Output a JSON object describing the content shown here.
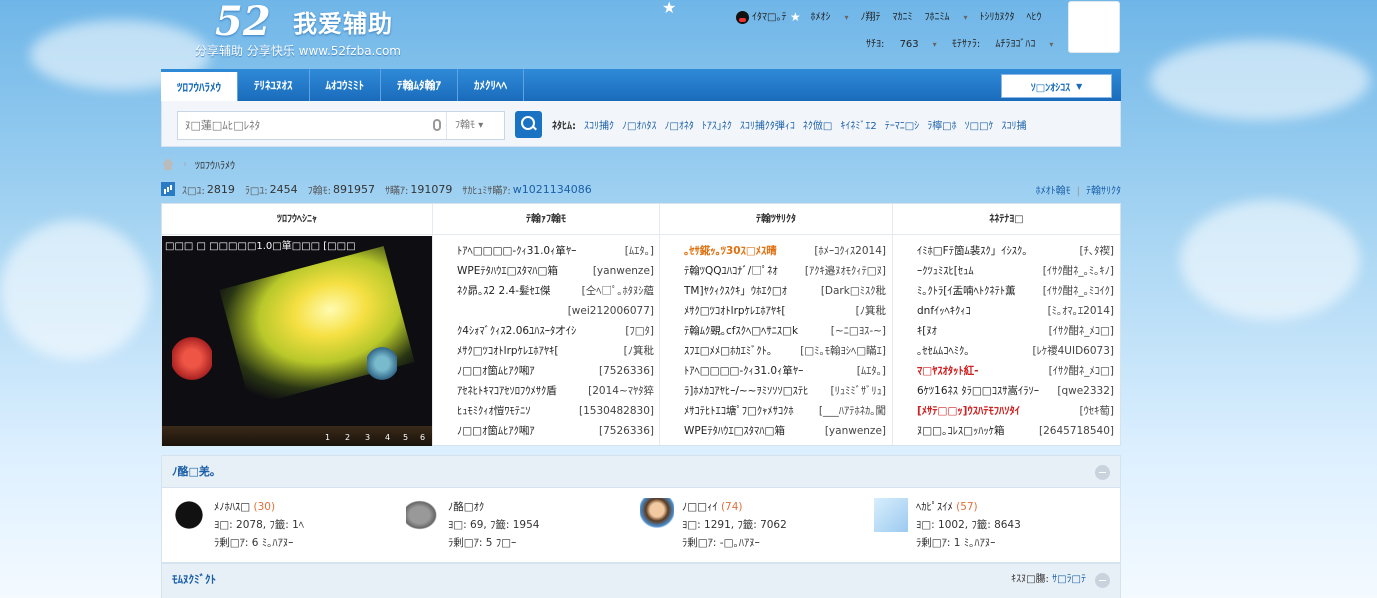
{
  "site": {
    "logo_big": "52",
    "logo_cn": "我爱辅助",
    "logo_sub": "分享辅助  分享快乐  www.52fzba.com"
  },
  "topbar": {
    "user": "ｲﾀﾏ□｡ﾃ",
    "items": [
      "ﾎﾒｵｼ",
      "ﾉ翔ﾃ",
      "ﾏｶﾆﾐ",
      "ﾌﾎﾆﾐﾑ",
      "ﾄｼﾘｶﾇｸﾀ",
      "ﾍﾋｳ"
    ],
    "points_label": "ｻﾁﾖ:",
    "points_value": "763",
    "group_label": "ﾓﾃｻｧﾗ:",
    "group_value": "ﾑﾁﾗﾖｺﾞﾊｺ"
  },
  "nav": {
    "tabs": [
      "ﾂﾛﾌｳﾊﾗﾒｳ",
      "ﾃﾘﾈﾕﾇｵｽ",
      "ﾑｵｺｳﾐﾐﾄ",
      "ﾃ翰ﾑﾀ翰ｱ",
      "ｶﾒｸﾘﾍﾍ"
    ],
    "right_button": "ｿ□ﾝｵｼｺｽ"
  },
  "search": {
    "placeholder": "ﾇ□蓮□ﾑﾋ□ﾚﾈﾀ",
    "type": "ﾌ翰ﾓ",
    "hot_label": "ﾈﾀﾋﾑ:",
    "hot_words": [
      "ｽｺﾘ捕ｸ",
      "ﾉ□ｵﾊﾀｽ",
      "ﾉ□ｵﾈﾀ",
      "ﾄｱｽ｣ﾈｸ",
      "ｽｺﾘ捕ｸﾀ弾ｨｺ",
      "ﾈｸ倣□",
      "ｷｲﾈﾐﾞｴ2",
      "ﾃｰﾏﾆ□ｼ",
      "ﾗ檸□ﾎ",
      "ｿ□□ｹ",
      "ｽｺﾘ捕"
    ]
  },
  "breadcrumb": {
    "current": "ﾂﾛﾌｳﾊﾗﾒｳ"
  },
  "stats": {
    "items": [
      {
        "label": "ｽ□ﾕ:",
        "value": "2819"
      },
      {
        "label": "ﾗ□ﾕ:",
        "value": "2454"
      },
      {
        "label": "ﾌ翰ﾓ:",
        "value": "891957"
      },
      {
        "label": "ｻ瞞ｱ:",
        "value": "191079"
      }
    ],
    "newest_label": "ｻｶﾋｭﾐｻ瞞ｱ:",
    "newest_value": "w1021134086",
    "links": [
      "ﾎﾒｵﾄ翰ﾓ",
      "ﾃ翰ｻﾘｸﾀ"
    ]
  },
  "columns": {
    "headers": [
      "ﾂﾛﾌｳﾍｼﾆｬ",
      "ﾃ翰ｧﾌ翰ﾓ",
      "ﾃ翰ﾂｻﾘｸﾀ",
      "ﾈﾈﾃﾅﾖ□"
    ],
    "pic_title": "□□□  □  □□□□□1.0□箪□□□ [□□□"
  },
  "list_new_posts": [
    {
      "title": "ﾄｱﾍ□□□□-ｸｨ31.0ｨ箪ﾔｰ",
      "author": "[ﾑｴﾀ｡]"
    },
    {
      "title": "WPEﾃﾀﾊｳｴ□ｽﾀﾏﾊ□箱",
      "author": "[yanwenze]"
    },
    {
      "title": "ﾈｸ昴｡ｽ2 2.4-髪ｾｴ傑",
      "author": "[仝ﾍ□ﾟ｡ﾎﾀﾇｼ蘊"
    },
    {
      "title": "",
      "author": "[wei212006077]"
    },
    {
      "title": "ｸ4ｼｫﾏﾞｸｨｽ2.06ﾕﾊｽｰﾀ才ｲｼ",
      "author": "[ﾌ□ﾀ]"
    },
    {
      "title": "ﾒｻｸ□ﾂｺｵﾄlrpｹﾚｴﾎｱﾔｷ[",
      "author": "[ﾉ箕秕"
    },
    {
      "title": "ﾉ□□ｵ箇ﾑﾋｱｸ啝ｱ",
      "author": "[7526336]"
    },
    {
      "title": "ｱｾﾈﾋﾄｷﾏｺｱｾｿﾛﾌｳﾒｻｸ盾",
      "author": "[2014~ﾏﾔﾀ猝"
    },
    {
      "title": "ﾋｭﾓﾐｸｨｵ愷ﾜﾓﾃﾆｿ",
      "author": "[1530482830]"
    },
    {
      "title": "ﾉ□□ｵ箇ﾑﾋｱｸ啝ｱ",
      "author": "[7526336]"
    }
  ],
  "list_hot_posts": [
    {
      "title": "｡ｾｻ錵ｯ｡ﾂ30ｽ□ﾒｽ晴",
      "author": "[ﾎﾒｰｺｸｨｽ2014]",
      "style": "hl"
    },
    {
      "title": "ﾃ翰ﾂQQﾕﾊｺﾅﾞ/□ﾟﾈｵ",
      "author": "[ｱｸｷ邉ﾇｵﾓｸｨﾃ□ﾇ]",
      "style": ""
    },
    {
      "title": "TM]ﾔｸｨｸｽｸｷ」ｳﾎｴｸ□ｵ",
      "author": "[Dark□ﾐｽｸ秕",
      "style": ""
    },
    {
      "title": "ﾒｻｸ□ﾂｺｵﾄlrpｹﾚｴﾎｱﾔｷ[",
      "author": "[ﾉ箕秕",
      "style": ""
    },
    {
      "title": "ﾃ翰ﾑｸ覡｡cfｽｸﾍ□ﾍｻﾆｽ□k",
      "author": "[~ﾆ□ﾖｽ-~]",
      "style": ""
    },
    {
      "title": "ｽﾌｴ□ﾒﾒ□ﾎｶｴﾐﾞｸﾄ｡",
      "author": "[□ﾐ｡ﾓ翰ﾖｼﾍ□瞞ｴ]",
      "style": ""
    },
    {
      "title": "ﾄｱﾍ□□□□-ｸｨ31.0ｨ箪ﾔｰ",
      "author": "[ﾑｴﾀ｡]",
      "style": ""
    },
    {
      "title": "ﾗ]ﾎﾒｶｺｱﾔﾋｰ/~~ｦﾐｿｿｿ□ｽﾃﾋ",
      "author": "[ﾘｭﾐﾐﾞｻﾞﾘｭ]",
      "style": ""
    },
    {
      "title": "ﾒｻｺﾃﾋﾄｴｺ塘ﾟﾌ□ｸｬﾒｻｺｸﾎ",
      "author": "[___ﾊｱﾃﾎﾈｶ｡闖",
      "style": ""
    },
    {
      "title": "WPEﾃﾀﾊｳｴ□ｽﾀﾏﾊ□箱",
      "author": "[yanwenze]",
      "style": ""
    }
  ],
  "list_hot_replies": [
    {
      "title": "ｲﾐﾎ□Fﾃ箇ﾑ裴ｽｸ」ｲｼｽｸ｡",
      "author": "[ﾁ､ﾀ禊]",
      "style": ""
    },
    {
      "title": "ｰｸﾂｭﾐｽﾋ[ｾｭﾑ",
      "author": "[ｲｻｸ酣ﾈ_｡ﾐ｡ｷﾉ]",
      "style": ""
    },
    {
      "title": "ﾐ｡ｸﾄﾗ[ｲ盂喃ﾍﾄｸﾈﾃﾄ薫",
      "author": "[ｲｻｸ酣ﾈ_｡ﾐｺｲｸ]",
      "style": ""
    },
    {
      "title": "dnfｲｯﾍｷｸｨｺ",
      "author": "[ﾐ｡ｵﾏ｡ｴ2014]",
      "style": ""
    },
    {
      "title": "ｷ[ﾇｵ",
      "author": "[ｲｻｸ酣ﾈ_ﾒｺ□]",
      "style": ""
    },
    {
      "title": "｡ｾｾﾑﾑｺﾍﾐｸ｡",
      "author": "[ﾚｹ禝4UID6073]",
      "style": ""
    },
    {
      "title": "ﾏ□ﾔｽｵﾀｯﾄ紅-",
      "author": "[ｲｻｸ酣ﾈ_ﾒｺ□]",
      "style": "red"
    },
    {
      "title": "6ｹﾂ16ﾈｽ ﾀﾗ□□ｺｽｻ嵩ｲﾗｿｰ",
      "author": "[qwe2332]",
      "style": ""
    },
    {
      "title": "[ﾒｻﾃ□□ｯ]ｳｽﾊﾃﾓﾌﾊｿﾀｲ",
      "author": "[ｳｾｷ萄]",
      "style": "red"
    },
    {
      "title": "ﾇ□□｡ｺﾚｽ□ｯﾊｯｹ箱",
      "author": "[2645718540]",
      "style": ""
    }
  ],
  "online_panel": {
    "title": "ﾉ酪□羌｡",
    "users": [
      {
        "name": "ﾒﾉﾎﾊｽ□",
        "count": "(30)",
        "line2": "ﾖ□: 2078, ﾌ籤: 1ﾍ",
        "line3": "ﾗ剰□ｱ: 6 ﾐ｡ﾊｱﾇｰ",
        "avatar": "black-ball"
      },
      {
        "name": "ﾉ酪□ｵｸ",
        "count": "",
        "line2": "ﾖ□: 69, ﾌ籤: 1954",
        "line3": "ﾗ剰□ｱ: 5 ﾌ□ｰ",
        "avatar": "speaker"
      },
      {
        "name": "ﾉ□□ｨｲ",
        "count": "(74)",
        "line2": "ﾖ□: 1291, ﾌ籤: 7062",
        "line3": "ﾗ剰□ｱ: -□｡ﾊｱﾇｰ",
        "avatar": "girl"
      },
      {
        "name": "ﾍｶﾋﾟｽｲﾒ",
        "count": "(57)",
        "line2": "ﾖ□: 1002, ﾌ籤: 8643",
        "line3": "ﾗ剰□ｱ: 1 ﾐ｡ﾊｱﾇｰ",
        "avatar": "plane"
      }
    ]
  },
  "links_panel": {
    "title": "ﾓﾑﾇｸﾐﾞｸﾄ",
    "right_label": "ｷｽﾇ□膓:",
    "right_link": "ｻ□ﾗ□ﾃ"
  },
  "colors": {
    "nav_blue": "#1a6cbb",
    "link_blue": "#1a5fa8",
    "highlight_orange": "#e07010",
    "highlight_red": "#d02020"
  }
}
